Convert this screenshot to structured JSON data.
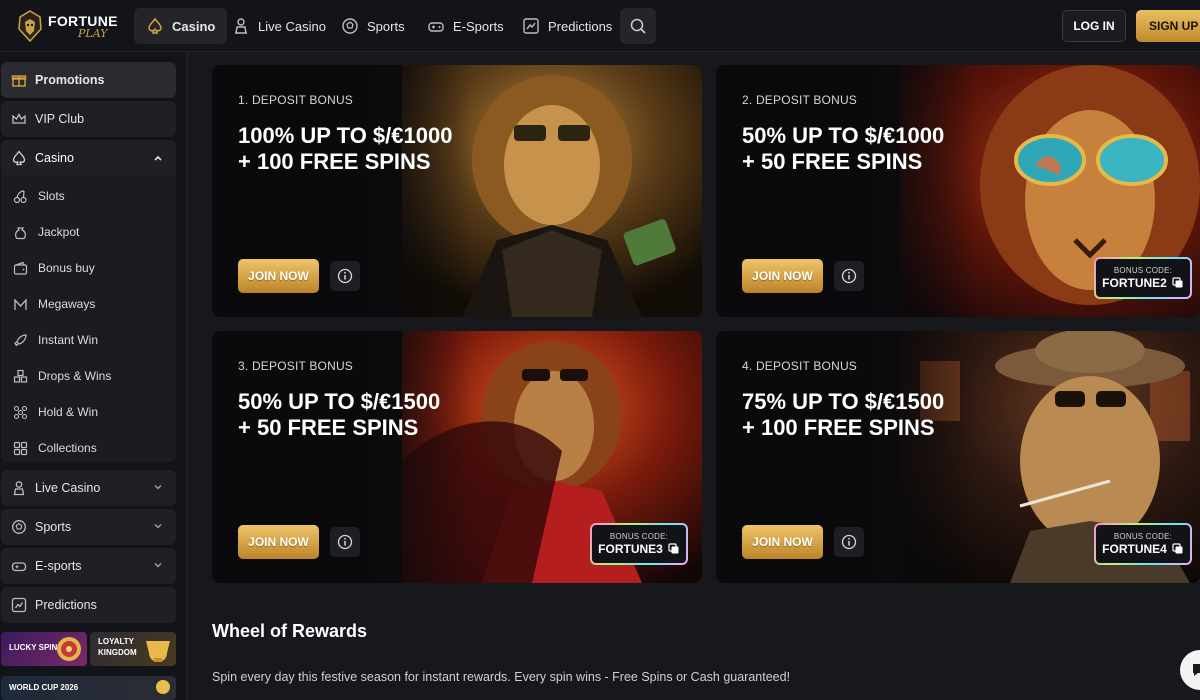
{
  "brand": {
    "name_line1": "FORTUNE",
    "name_line2": "PLAY"
  },
  "nav": {
    "tabs": [
      {
        "label": "Casino",
        "icon": "spade-icon",
        "active": true
      },
      {
        "label": "Live Casino",
        "icon": "dealer-icon"
      },
      {
        "label": "Sports",
        "icon": "football-icon"
      },
      {
        "label": "E-Sports",
        "icon": "gamepad-icon"
      },
      {
        "label": "Predictions",
        "icon": "chart-icon"
      }
    ],
    "search_icon": "search-icon",
    "login_label": "LOG IN",
    "signup_label": "SIGN UP"
  },
  "sidebar": {
    "promotions": "Promotions",
    "vip_club": "VIP Club",
    "casino": {
      "label": "Casino",
      "items": [
        "Slots",
        "Jackpot",
        "Bonus buy",
        "Megaways",
        "Instant Win",
        "Drops & Wins",
        "Hold & Win",
        "Collections"
      ]
    },
    "live_casino": "Live Casino",
    "sports": "Sports",
    "esports": "E-sports",
    "predictions": "Predictions",
    "tiles": [
      {
        "label_line1": "LUCKY SPIN",
        "label_line2": ""
      },
      {
        "label_line1": "LOYALTY",
        "label_line2": "KINGDOM"
      },
      {
        "label_line1": "WORLD CUP 2026",
        "label_line2": ""
      }
    ]
  },
  "bonuses": [
    {
      "kicker": "1. DEPOSIT BONUS",
      "line1": "100% UP TO $/€1000",
      "line2": "+ 100 FREE SPINS",
      "join": "JOIN NOW",
      "code_label": "",
      "code": ""
    },
    {
      "kicker": "2. DEPOSIT BONUS",
      "line1": "50% UP TO $/€1000",
      "line2": "+ 50 FREE SPINS",
      "join": "JOIN NOW",
      "code_label": "BONUS CODE:",
      "code": "FORTUNE2"
    },
    {
      "kicker": "3. DEPOSIT BONUS",
      "line1": "50% UP TO $/€1500",
      "line2": "+ 50 FREE SPINS",
      "join": "JOIN NOW",
      "code_label": "BONUS CODE:",
      "code": "FORTUNE3"
    },
    {
      "kicker": "4. DEPOSIT BONUS",
      "line1": "75% UP TO $/€1500",
      "line2": "+ 100 FREE SPINS",
      "join": "JOIN NOW",
      "code_label": "BONUS CODE:",
      "code": "FORTUNE4"
    }
  ],
  "wheel": {
    "title": "Wheel of Rewards",
    "description": "Spin every day this festive season for instant rewards. Every spin wins - Free Spins or Cash guaranteed!"
  },
  "colors": {
    "gold": "#d4a23f",
    "background": "#17181c",
    "panel": "#1f2026"
  }
}
